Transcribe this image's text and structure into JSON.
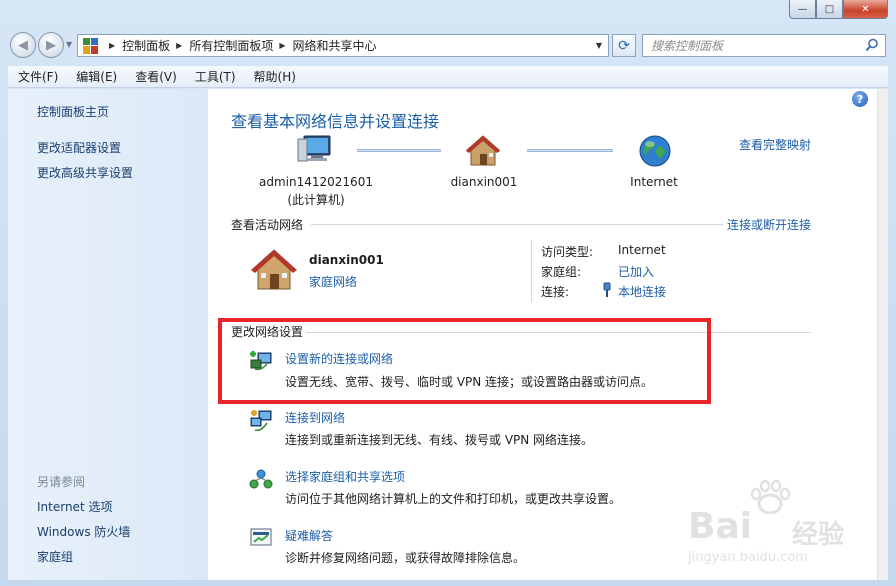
{
  "window": {
    "minimize_glyph": "—",
    "maximize_glyph": "□",
    "close_glyph": "✕"
  },
  "address": {
    "breadcrumbs": [
      "控制面板",
      "所有控制面板项",
      "网络和共享中心"
    ],
    "search_placeholder": "搜索控制面板"
  },
  "menu": [
    "文件(F)",
    "编辑(E)",
    "查看(V)",
    "工具(T)",
    "帮助(H)"
  ],
  "sidebar": {
    "links": [
      "控制面板主页",
      "更改适配器设置",
      "更改高级共享设置"
    ],
    "see_also_heading": "另请参阅",
    "see_also": [
      "Internet 选项",
      "Windows 防火墙",
      "家庭组"
    ]
  },
  "main": {
    "title": "查看基本网络信息并设置连接",
    "full_map_link": "查看完整映射",
    "map": {
      "computer_name": "admin1412021601",
      "computer_sub": "(此计算机)",
      "network_name": "dianxin001",
      "internet_label": "Internet"
    },
    "active_networks": {
      "heading": "查看活动网络",
      "connect_link": "连接或断开连接",
      "network_name": "dianxin001",
      "network_type": "家庭网络",
      "access_type_label": "访问类型:",
      "access_type_value": "Internet",
      "homegroup_label": "家庭组:",
      "homegroup_value": "已加入",
      "connections_label": "连接:",
      "connections_value": "本地连接"
    },
    "change_settings": {
      "heading": "更改网络设置",
      "tasks": [
        {
          "link": "设置新的连接或网络",
          "desc": "设置无线、宽带、拨号、临时或 VPN 连接；或设置路由器或访问点。",
          "icon": "new-connection-icon"
        },
        {
          "link": "连接到网络",
          "desc": "连接到或重新连接到无线、有线、拨号或 VPN 网络连接。",
          "icon": "connect-network-icon"
        },
        {
          "link": "选择家庭组和共享选项",
          "desc": "访问位于其他网络计算机上的文件和打印机，或更改共享设置。",
          "icon": "homegroup-icon"
        },
        {
          "link": "疑难解答",
          "desc": "诊断并修复网络问题，或获得故障排除信息。",
          "icon": "troubleshoot-icon"
        }
      ]
    }
  },
  "watermark": {
    "brand": "Bai",
    "brand_suffix": "经验",
    "url": "jingyan.baidu.com"
  },
  "colors": {
    "link": "#1d5ea8",
    "title": "#1c5fa8",
    "highlight": "#e8262a",
    "sidebar_bg": "#e4eefa"
  }
}
